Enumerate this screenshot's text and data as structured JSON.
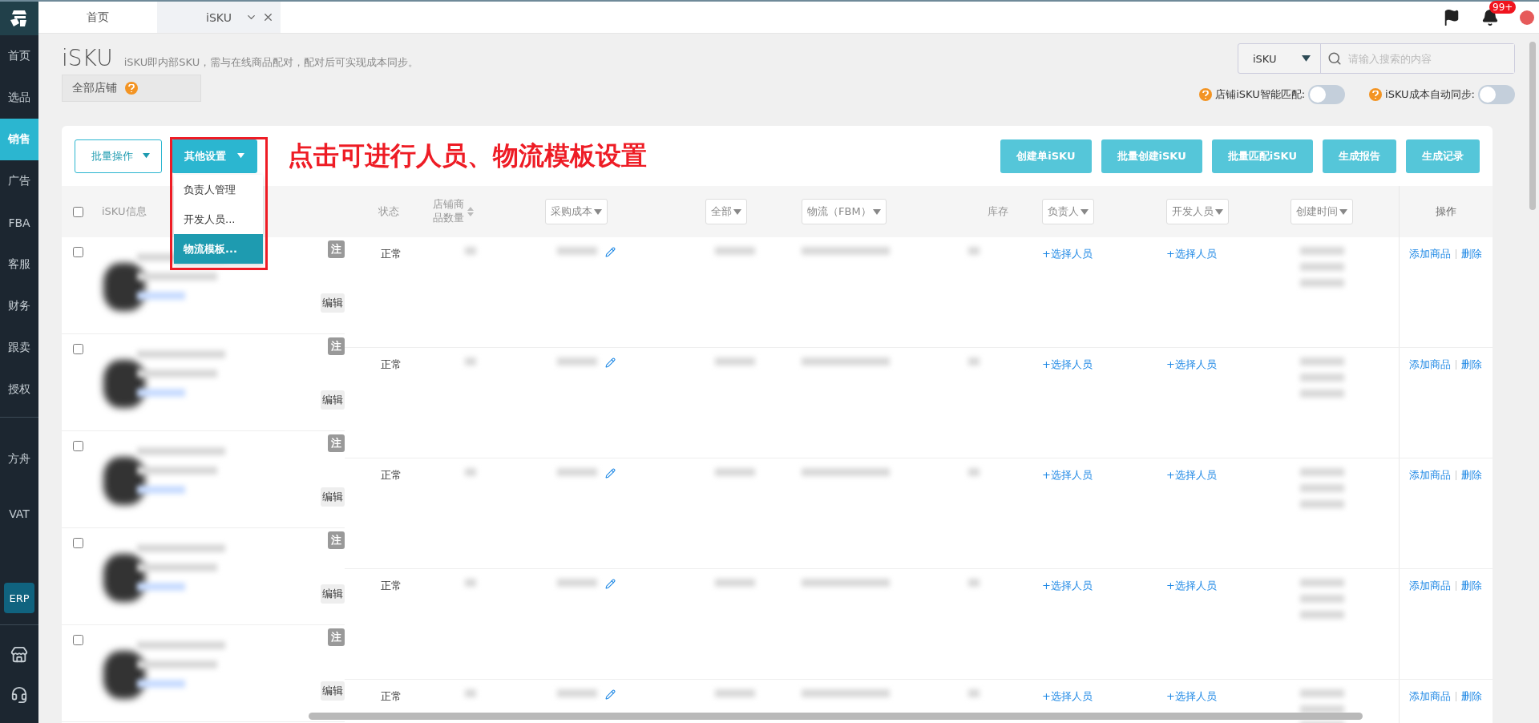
{
  "sidebar": {
    "items": [
      {
        "label": "首页",
        "selected": false
      },
      {
        "label": "选品",
        "selected": false
      },
      {
        "label": "销售",
        "selected": true
      },
      {
        "label": "广告",
        "selected": false
      },
      {
        "label": "FBA",
        "selected": false
      },
      {
        "label": "客服",
        "selected": false
      },
      {
        "label": "财务",
        "selected": false
      },
      {
        "label": "跟卖",
        "selected": false
      },
      {
        "label": "授权",
        "selected": false
      }
    ],
    "extra_items": [
      {
        "label": "方舟",
        "selected": false
      },
      {
        "label": "VAT",
        "selected": false
      }
    ],
    "erp_badge": "ERP"
  },
  "tabs": [
    {
      "label": "首页",
      "selected": false
    },
    {
      "label": "iSKU",
      "selected": true
    }
  ],
  "notification_count": "99+",
  "page": {
    "title": "iSKU",
    "description": "iSKU即内部SKU，需与在线商品配对，配对后可实现成本同步。",
    "store_filter": "全部店铺"
  },
  "search": {
    "scope": "iSKU",
    "placeholder": "请输入搜索的内容"
  },
  "toggles": [
    {
      "label": "店铺iSKU智能匹配:",
      "on": false
    },
    {
      "label": "iSKU成本自动同步:",
      "on": false
    }
  ],
  "toolbar": {
    "batch_button": "批量操作",
    "settings_button": "其他设置",
    "menu": [
      {
        "label": "负责人管理",
        "selected": false
      },
      {
        "label": "开发人员...",
        "selected": false
      },
      {
        "label": "物流模板...",
        "selected": true
      }
    ],
    "annotation": "点击可进行人员、物流模板设置",
    "actions": [
      "创建单iSKU",
      "批量创建iSKU",
      "批量匹配iSKU",
      "生成报告",
      "生成记录"
    ]
  },
  "table": {
    "columns": [
      {
        "label": "iSKU信息",
        "kind": "text"
      },
      {
        "label": "状态",
        "kind": "text"
      },
      {
        "label": "店铺商品数量",
        "kind": "sort"
      },
      {
        "label": "采购成本",
        "kind": "filter"
      },
      {
        "label": "全部",
        "kind": "filter"
      },
      {
        "label": "物流（FBM）",
        "kind": "filter"
      },
      {
        "label": "库存",
        "kind": "text"
      },
      {
        "label": "负责人",
        "kind": "filter"
      },
      {
        "label": "开发人员",
        "kind": "filter"
      },
      {
        "label": "创建时间",
        "kind": "filter"
      },
      {
        "label": "操作",
        "kind": "text"
      }
    ],
    "all_checked": false,
    "rows": [
      {
        "checked": false,
        "status": "正常",
        "note_badge": "注",
        "edit_button": "编辑",
        "owner_link": "+选择人员",
        "developer_link": "+选择人员",
        "actions": [
          "添加商品",
          "删除"
        ]
      },
      {
        "checked": false,
        "status": "正常",
        "note_badge": "注",
        "edit_button": "编辑",
        "owner_link": "+选择人员",
        "developer_link": "+选择人员",
        "actions": [
          "添加商品",
          "删除"
        ]
      },
      {
        "checked": false,
        "status": "正常",
        "note_badge": "注",
        "edit_button": "编辑",
        "owner_link": "+选择人员",
        "developer_link": "+选择人员",
        "actions": [
          "添加商品",
          "删除"
        ]
      },
      {
        "checked": false,
        "status": "正常",
        "note_badge": "注",
        "edit_button": "编辑",
        "owner_link": "+选择人员",
        "developer_link": "+选择人员",
        "actions": [
          "添加商品",
          "删除"
        ]
      },
      {
        "checked": false,
        "status": "正常",
        "note_badge": "注",
        "edit_button": "编辑",
        "owner_link": "+选择人员",
        "developer_link": "+选择人员",
        "actions": [
          "添加商品",
          "删除"
        ]
      }
    ]
  }
}
